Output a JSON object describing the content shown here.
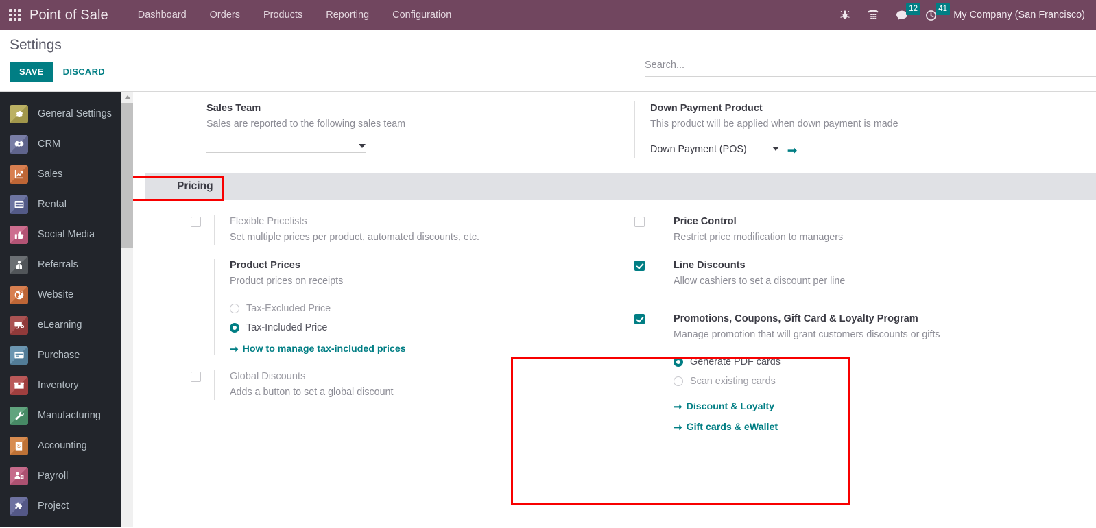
{
  "navbar": {
    "apps_icon": "apps-grid-icon",
    "brand": "Point of Sale",
    "menu": [
      {
        "label": "Dashboard"
      },
      {
        "label": "Orders"
      },
      {
        "label": "Products"
      },
      {
        "label": "Reporting"
      },
      {
        "label": "Configuration"
      }
    ],
    "icons": [
      {
        "name": "bug-icon",
        "badge": null
      },
      {
        "name": "phone-dialpad-icon",
        "badge": null
      },
      {
        "name": "messages-icon",
        "badge": "12"
      },
      {
        "name": "activities-clock-icon",
        "badge": "41"
      }
    ],
    "company": "My Company (San Francisco)",
    "background_color": "#71465f",
    "badge_color": "#017e84"
  },
  "control_panel": {
    "title": "Settings",
    "save_label": "SAVE",
    "discard_label": "DISCARD",
    "accent_color": "#017e84"
  },
  "search": {
    "placeholder": "Search...",
    "value": ""
  },
  "sidebar": {
    "items": [
      {
        "label": "General Settings",
        "icon": "gear-icon",
        "color": "#b3a853"
      },
      {
        "label": "CRM",
        "icon": "handshake-icon",
        "color": "#6a6f9c"
      },
      {
        "label": "Sales",
        "icon": "chart-up-icon",
        "color": "#d4713c"
      },
      {
        "label": "Rental",
        "icon": "calendar-icon",
        "color": "#5c6496"
      },
      {
        "label": "Social Media",
        "icon": "thumbs-up-icon",
        "color": "#c75e82"
      },
      {
        "label": "Referrals",
        "icon": "person-gift-icon",
        "color": "#5a5f63"
      },
      {
        "label": "Website",
        "icon": "globe-icon",
        "color": "#d3713c"
      },
      {
        "label": "eLearning",
        "icon": "presentation-icon",
        "color": "#a04040"
      },
      {
        "label": "Purchase",
        "icon": "card-icon",
        "color": "#5b8aa8"
      },
      {
        "label": "Inventory",
        "icon": "box-icon",
        "color": "#b24646"
      },
      {
        "label": "Manufacturing",
        "icon": "wrench-icon",
        "color": "#4f9a70"
      },
      {
        "label": "Accounting",
        "icon": "invoice-dollar-icon",
        "color": "#d47f3c"
      },
      {
        "label": "Payroll",
        "icon": "person-badge-icon",
        "color": "#bf5a7e"
      },
      {
        "label": "Project",
        "icon": "puzzle-icon",
        "color": "#5d6296"
      }
    ]
  },
  "settings": {
    "top_group": {
      "left": {
        "title": "Sales Team",
        "desc": "Sales are reported to the following sales team",
        "select_value": ""
      },
      "right": {
        "title": "Down Payment Product",
        "desc": "This product will be applied when down payment is made",
        "select_value": "Down Payment (POS)",
        "internal_link_icon": "arrow-right-icon"
      }
    },
    "pricing_section": {
      "heading": "Pricing",
      "left": {
        "flexible_pricelists": {
          "title": "Flexible Pricelists",
          "desc": "Set multiple prices per product, automated discounts, etc.",
          "checked": false,
          "disabled": true
        },
        "product_prices": {
          "title": "Product Prices",
          "desc": "Product prices on receipts",
          "options": [
            {
              "label": "Tax-Excluded Price",
              "selected": false
            },
            {
              "label": "Tax-Included Price",
              "selected": true
            }
          ],
          "link": "How to manage tax-included prices"
        },
        "global_discounts": {
          "title": "Global Discounts",
          "desc": "Adds a button to set a global discount",
          "checked": false,
          "disabled": true
        }
      },
      "right": {
        "price_control": {
          "title": "Price Control",
          "desc": "Restrict price modification to managers",
          "checked": false
        },
        "line_discounts": {
          "title": "Line Discounts",
          "desc": "Allow cashiers to set a discount per line",
          "checked": true
        },
        "promotions": {
          "title": "Promotions, Coupons, Gift Card & Loyalty Program",
          "desc": "Manage promotion that will grant customers discounts or gifts",
          "checked": true,
          "options": [
            {
              "label": "Generate PDF cards",
              "selected": true
            },
            {
              "label": "Scan existing cards",
              "selected": false
            }
          ],
          "links": [
            {
              "label": "Discount & Loyalty"
            },
            {
              "label": "Gift cards & eWallet"
            }
          ]
        }
      }
    }
  },
  "annotations": {
    "color": "#f80000",
    "boxes": [
      {
        "name": "pricing-heading-highlight"
      },
      {
        "name": "promotions-panel-highlight"
      }
    ]
  }
}
